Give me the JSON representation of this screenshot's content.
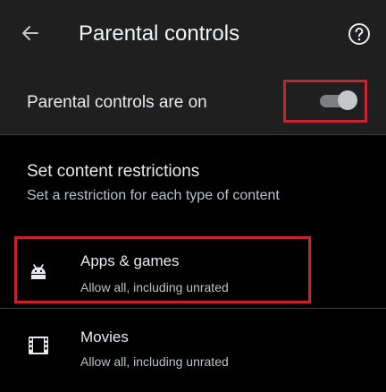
{
  "header": {
    "title": "Parental controls",
    "back_icon": "arrow-left-icon",
    "help_icon": "help-circle-icon"
  },
  "master_toggle": {
    "label": "Parental controls are on",
    "state": "on"
  },
  "restrictions": {
    "title": "Set content restrictions",
    "subtitle": "Set a restriction for each type of content",
    "items": [
      {
        "icon": "android-icon",
        "title": "Apps & games",
        "subtitle": "Allow all, including unrated"
      },
      {
        "icon": "movie-icon",
        "title": "Movies",
        "subtitle": "Allow all, including unrated"
      }
    ]
  },
  "colors": {
    "background": "#000000",
    "surface": "#1f1f1f",
    "text_primary": "#e8eaed",
    "text_secondary": "#bdc1c6",
    "highlight": "#c8232c",
    "toggle_track": "#7b7f84",
    "toggle_thumb": "#c4c7ca"
  }
}
